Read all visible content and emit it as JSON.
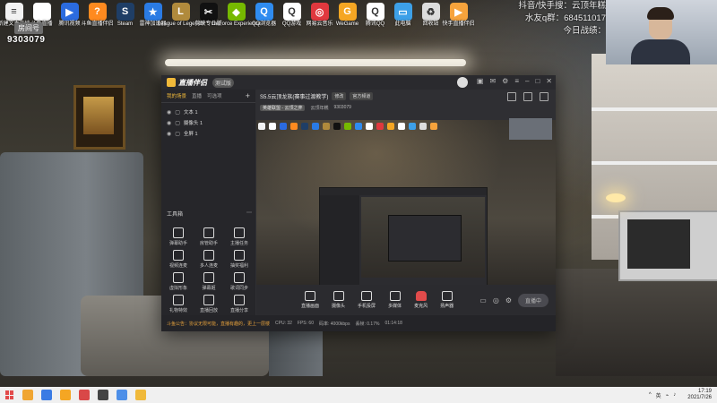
{
  "desktop": {
    "icons": [
      {
        "label": "新建文本文档",
        "glyph": "≡",
        "color": "#f2f2f2"
      },
      {
        "label": "斗鱼直播",
        "glyph": "",
        "color": "#ffffff"
      },
      {
        "label": "腾讯视频",
        "glyph": "▶",
        "color": "#2b6bdf"
      },
      {
        "label": "斗鱼直播伴侣",
        "glyph": "?",
        "color": "#ff8a1f"
      },
      {
        "label": "Steam",
        "glyph": "S",
        "color": "#1f3e66"
      },
      {
        "label": "雷神加速器",
        "glyph": "★",
        "color": "#2a7be4"
      },
      {
        "label": "League of Legends",
        "glyph": "L",
        "color": "#b08a3c"
      },
      {
        "label": "剪映专业版",
        "glyph": "✂",
        "color": "#111111"
      },
      {
        "label": "GeForce Experience",
        "glyph": "◆",
        "color": "#76b900"
      },
      {
        "label": "QQ浏览器",
        "glyph": "Q",
        "color": "#2f8cf0"
      },
      {
        "label": "QQ游戏",
        "glyph": "Q",
        "color": "#ffffff"
      },
      {
        "label": "网易云音乐",
        "glyph": "◎",
        "color": "#e0383e"
      },
      {
        "label": "WeGame",
        "glyph": "G",
        "color": "#f5a623"
      },
      {
        "label": "腾讯QQ",
        "glyph": "Q",
        "color": "#ffffff"
      },
      {
        "label": "此电脑",
        "glyph": "▭",
        "color": "#3da0e8"
      },
      {
        "label": "回收站",
        "glyph": "♻",
        "color": "#dcdcdc"
      },
      {
        "label": "快手直播伴侣",
        "glyph": "▶",
        "color": "#f6a33c"
      }
    ]
  },
  "room": {
    "badge": "房间号",
    "number": "9303079"
  },
  "stream_info": {
    "line1": "抖音/快手搜：云顶年糕",
    "line2": "水友q群：684511017",
    "line3": "今日战绩："
  },
  "app": {
    "name": "直播伴侣",
    "version": "测试版",
    "left_tabs": [
      "我的场景",
      "直播",
      "可选项"
    ],
    "add_icon": "+",
    "sources": [
      {
        "name": "文本 1"
      },
      {
        "name": "摄像头 1"
      },
      {
        "name": "全屏 1"
      }
    ],
    "tools_title": "工具箱",
    "tools_more": "⋯",
    "tools": [
      "弹幕助手",
      "房管助手",
      "主播任务",
      "视频连麦",
      "多人连麦",
      "抽奖福利",
      "虚拟形象",
      "弹幕姬",
      "歌词同步",
      "礼物特效",
      "直播回放",
      "直播分享"
    ],
    "preview_title": "S5.5云顶龙族(赛事过渡教学)",
    "preview_chip1": "修改",
    "preview_chip2": "官方频道",
    "row2_category": "英雄联盟 - 云顶之弈",
    "row2_label": "云顶年糕",
    "row2_room": "9303079",
    "bottom_items": [
      {
        "label": "直播画面",
        "name": "stream-screen"
      },
      {
        "label": "摄像头",
        "name": "camera"
      },
      {
        "label": "手机投屏",
        "name": "phone-cast"
      },
      {
        "label": "多媒体",
        "name": "media"
      },
      {
        "label": "麦克风",
        "name": "mic"
      },
      {
        "label": "扬声器",
        "name": "speaker"
      }
    ],
    "start_button": "直播中",
    "status": {
      "warn": "斗鱼公告：协议无限可能，直播有趣的，更上一层楼",
      "cpu": "CPU: 32",
      "fps": "FPS: 60",
      "bitrate": "码率: 4000kbps",
      "drop": "丢帧: 0.17%",
      "duration": "01:14:18"
    }
  },
  "taskbar": {
    "clock_time": "17:19",
    "clock_date": "2021/7/26",
    "tray": [
      "^",
      "英",
      "⌁",
      "♪"
    ]
  }
}
